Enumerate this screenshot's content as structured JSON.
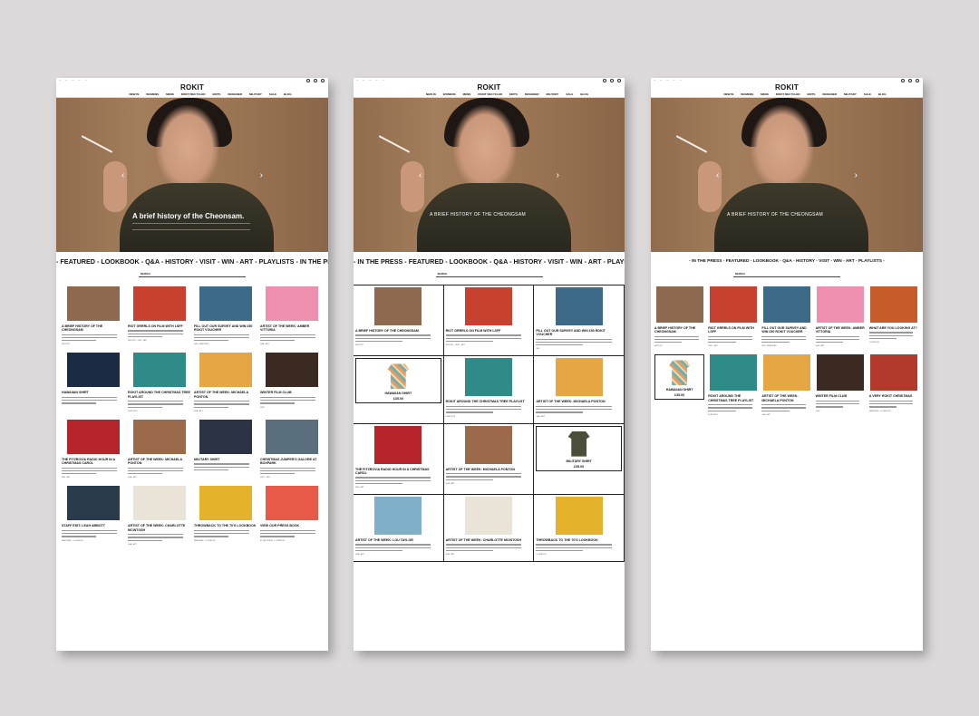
{
  "site": {
    "logo": "ROKIT",
    "utility_links": [
      "•••",
      "•••",
      "•••",
      "•••",
      "•••"
    ],
    "nav": [
      "NEW IN",
      "WOMENS",
      "MENS",
      "ROKIT RECYCLED",
      "EDITS",
      "DESIGNER",
      "MILITARY",
      "SALE",
      "BLOG"
    ],
    "search_label": "SEARCH"
  },
  "hero": {
    "caption_1": "A brief history of the Cheonsam.",
    "caption_2": "A BRIEF HISTORY OF THE CHEONGSAM",
    "caption_3": "A BRIEF HISTORY OF THE CHEONGSAM"
  },
  "category_bars": {
    "m1": "- FEATURED - LOOKBOOK - Q&A - HISTORY - VISIT - WIN - ART - PLAYLISTS - IN THE PRESS -",
    "m2": "- IN THE PRESS - FEATURED - LOOKBOOK - Q&A - HISTORY - VISIT - WIN - ART - PLAYLISTS -",
    "m3": "- IN THE PRESS - FEATURED - LOOKBOOK - Q&A - HISTORY - VISIT - WIN - ART - PLAYLISTS -"
  },
  "m1_cards": [
    {
      "title": "A BRIEF HISTORY OF THE CHEONGSAM",
      "tag": "HISTORY",
      "color": "#8d6a4f"
    },
    {
      "title": "RIOT GRRRLS ON FILM WITH LSFF",
      "tag": "HISTORY · VISIT · ART",
      "color": "#c8402f"
    },
    {
      "title": "FILL OUT OUR SURVEY AND WIN £50 ROKIT VOUCHER",
      "tag": "WIN · FEATURED",
      "color": "#3e6a8a"
    },
    {
      "title": "ARTIST OF THE WEEK: AMBER VITTORIA",
      "tag": "Q&A · ART",
      "color": "#ef8fb0"
    },
    {
      "title": "HAWAIIAN SHIRT",
      "tag": "",
      "color": "#1b2b44"
    },
    {
      "title": "ROKIT AROUND THE CHRISTMAS TREE PLAYLIST",
      "tag": "PLAYLISTS",
      "color": "#2e8b87"
    },
    {
      "title": "ARTIST OF THE WEEK: MICHAELA PONTON",
      "tag": "Q&A · ART",
      "color": "#e7a644"
    },
    {
      "title": "WINTER FILM CLUB",
      "tag": "VISIT",
      "color": "#3a2a22"
    },
    {
      "title": "THE FITZROVIA RADIO HOUR IN A CHRISTMAS CAROL",
      "tag": "WIN · ART",
      "color": "#b6232a"
    },
    {
      "title": "ARTIST OF THE WEEK: MICHAELA PONTON",
      "tag": "Q&A · ART",
      "color": "#9a6a4a"
    },
    {
      "title": "MILITARY SHIRT",
      "tag": "",
      "color": "#2b3344"
    },
    {
      "title": "CHRISTMAS JUMPER'S GALORE AT BOXPARK",
      "tag": "VISIT · WIN",
      "color": "#5a6f7e"
    },
    {
      "title": "STAFF EDIT: LEAH ABBOTT",
      "tag": "FEATURED · LOOKBOOK",
      "color": "#2a3c4c"
    },
    {
      "title": "ARTIST OF THE WEEK: CHARLOTTE MCINTOSH",
      "tag": "Q&A · ART",
      "color": "#e9e3d8"
    },
    {
      "title": "THROWBACK TO THE 70'S LOOKBOOK",
      "tag": "FEATURED · LOOKBOOK",
      "color": "#e5b22c"
    },
    {
      "title": "VIEW OUR PRESS BOOK",
      "tag": "IN THE PRESS · LOOKBOOK",
      "color": "#e85a48"
    }
  ],
  "m2_cards": [
    {
      "title": "A BRIEF HISTORY OF THE CHEONGSAM",
      "tag": "HISTORY",
      "color": "#8d6a4f"
    },
    {
      "title": "RIOT GRRRLS ON FILM WITH LSFF",
      "tag": "HISTORY · VISIT · ART",
      "color": "#c8402f"
    },
    {
      "title": "FILL OUT OUR SURVEY AND WIN £50 ROKIT VOUCHER",
      "tag": "WIN",
      "color": "#3e6a8a"
    },
    {
      "title": "HAWAIIAN SHIRT",
      "price": "£35.00",
      "color": "#1b2b44"
    },
    {
      "title": "ROKIT AROUND THE CHRISTMAS TREE PLAYLIST",
      "tag": "PLAYLISTS",
      "color": "#2e8b87"
    },
    {
      "title": "ARTIST OF THE WEEK: MICHAELA PONTON",
      "tag": "Q&A · ART",
      "color": "#e7a644"
    },
    {
      "title": "THE FITZROVIA RADIO HOUR IN A CHRISTMAS CAROL",
      "tag": "WIN · ART",
      "color": "#b6232a"
    },
    {
      "title": "ARTIST OF THE WEEK: MICHAELA PONTON",
      "tag": "Q&A · ART",
      "color": "#9a6a4a"
    },
    {
      "title": "MILITARY SHIRT",
      "price": "£35.00",
      "color": "#2b3344"
    },
    {
      "title": "ARTIST OF THE WEEK: LOU TAYLOR",
      "tag": "Q&A · ART",
      "color": "#7fb0c8"
    },
    {
      "title": "ARTIST OF THE WEEK: CHARLOTTE MCINTOSH",
      "tag": "Q&A · ART",
      "color": "#e9e3d8"
    },
    {
      "title": "THROWBACK TO THE 70'S LOOKBOOK",
      "tag": "LOOKBOOK",
      "color": "#e5b22c"
    }
  ],
  "m3_cards": [
    {
      "title": "A BRIEF HISTORY OF THE CHEONGSAM",
      "tag": "HISTORY",
      "color": "#8d6a4f"
    },
    {
      "title": "RIOT GRRRLS ON FILM WITH LSFF",
      "tag": "VISIT · ART",
      "color": "#c8402f"
    },
    {
      "title": "FILL OUT OUR SURVEY AND WIN £50 ROKIT VOUCHER",
      "tag": "WIN · FEATURED",
      "color": "#3e6a8a"
    },
    {
      "title": "ARTIST OF THE WEEK: AMBER VITTORIA",
      "tag": "Q&A · ART",
      "color": "#ef8fb0"
    },
    {
      "title": "WHAT ARE YOU LOOKING AT?",
      "tag": "LOOKBOOK",
      "color": "#c85b2a"
    },
    {
      "title": "HAWAIIAN SHIRT",
      "price": "£35.00",
      "color": "#1b2b44"
    },
    {
      "title": "ROKIT AROUND THE CHRISTMAS TREE PLAYLIST",
      "tag": "PLAYLISTS",
      "color": "#2e8b87"
    },
    {
      "title": "ARTIST OF THE WEEK: MICHAELA PONTON",
      "tag": "Q&A · ART",
      "color": "#e7a644"
    },
    {
      "title": "WINTER FILM CLUB",
      "tag": "VISIT",
      "color": "#3a2a22"
    },
    {
      "title": "A VERY ROKIT CHRISTMAS",
      "tag": "FEATURED · LOOKBOOK",
      "color": "#b23a2c"
    }
  ]
}
